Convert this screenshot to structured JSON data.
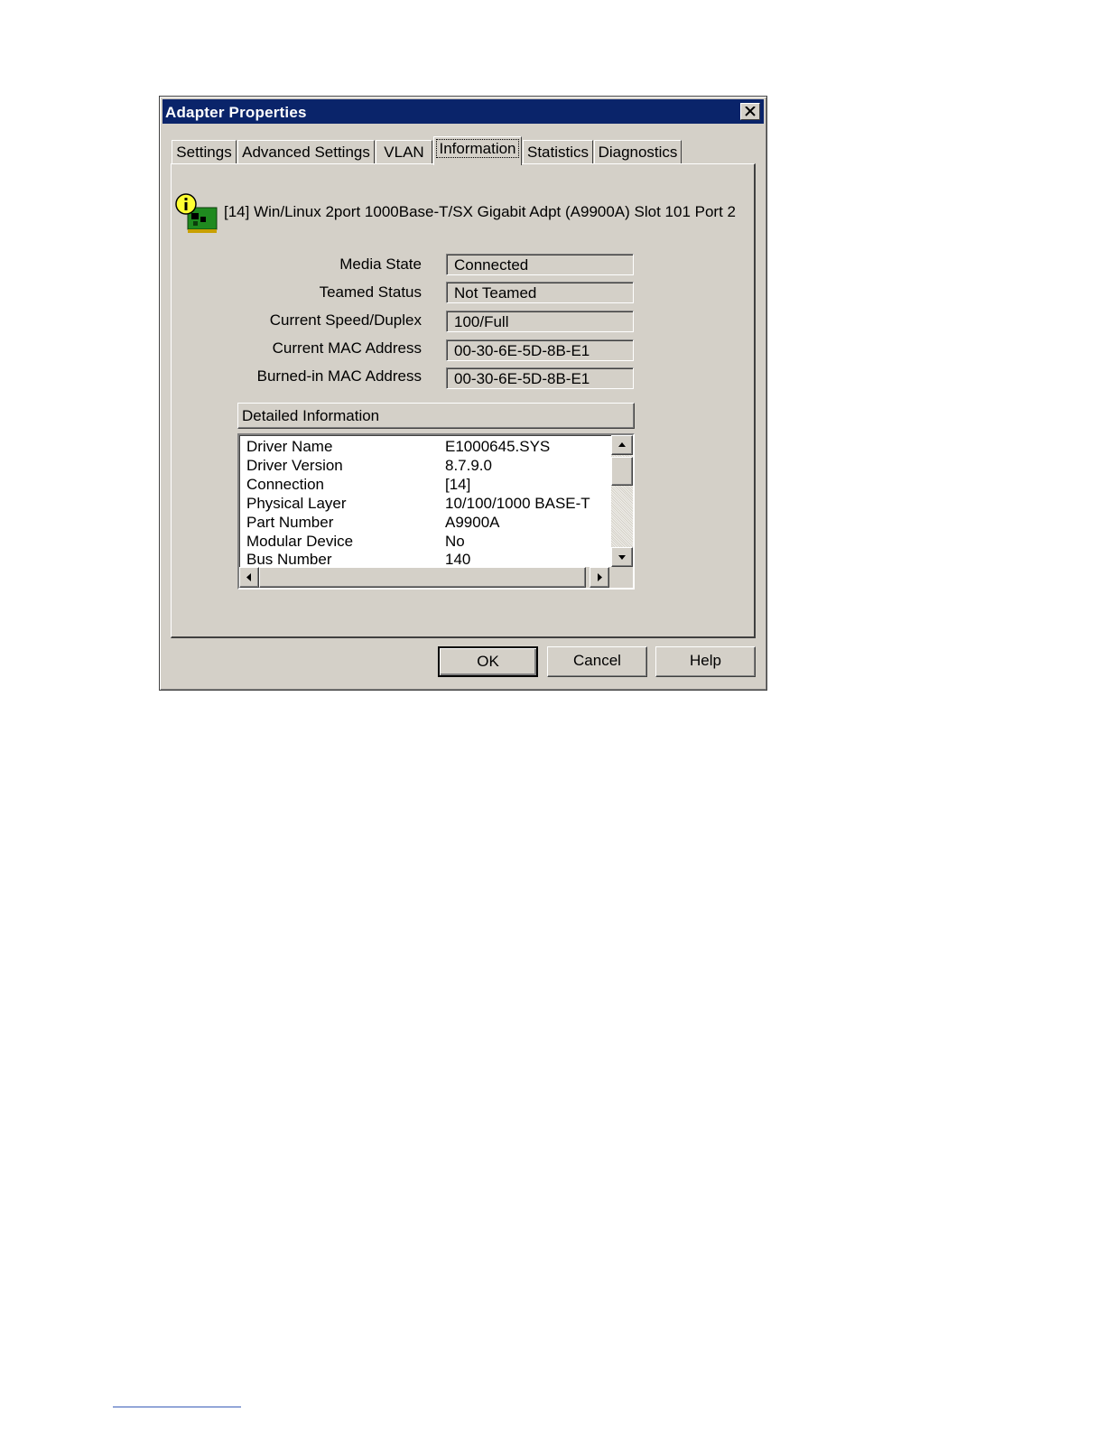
{
  "window": {
    "title": "Adapter Properties"
  },
  "tabs": [
    {
      "label": "Settings",
      "active": false
    },
    {
      "label": "Advanced Settings",
      "active": false
    },
    {
      "label": "VLAN",
      "active": false
    },
    {
      "label": "Information",
      "active": true
    },
    {
      "label": "Statistics",
      "active": false
    },
    {
      "label": "Diagnostics",
      "active": false
    }
  ],
  "adapter": {
    "name": "[14] Win/Linux 2port 1000Base-T/SX Gigabit Adpt (A9900A) Slot 101 Port 2"
  },
  "properties": [
    {
      "label": "Media State",
      "value": "Connected"
    },
    {
      "label": "Teamed Status",
      "value": "Not Teamed"
    },
    {
      "label": "Current Speed/Duplex",
      "value": "100/Full"
    },
    {
      "label": "Current MAC Address",
      "value": "00-30-6E-5D-8B-E1"
    },
    {
      "label": "Burned-in MAC Address",
      "value": "00-30-6E-5D-8B-E1"
    }
  ],
  "details": {
    "header": "Detailed Information",
    "rows": [
      {
        "key": "Driver Name",
        "value": "E1000645.SYS"
      },
      {
        "key": "Driver Version",
        "value": "8.7.9.0"
      },
      {
        "key": "Connection",
        "value": "[14]"
      },
      {
        "key": "Physical Layer",
        "value": "10/100/1000 BASE-T"
      },
      {
        "key": "Part Number",
        "value": "A9900A"
      },
      {
        "key": "Modular Device",
        "value": "No"
      },
      {
        "key": "Bus Number",
        "value": "140"
      }
    ]
  },
  "buttons": {
    "ok": "OK",
    "cancel": "Cancel",
    "help": "Help"
  },
  "icons": {
    "adapter": "network-adapter-info-icon",
    "close": "close-icon"
  },
  "colors": {
    "titlebar": "#0a246a",
    "face": "#d4d0c8"
  }
}
